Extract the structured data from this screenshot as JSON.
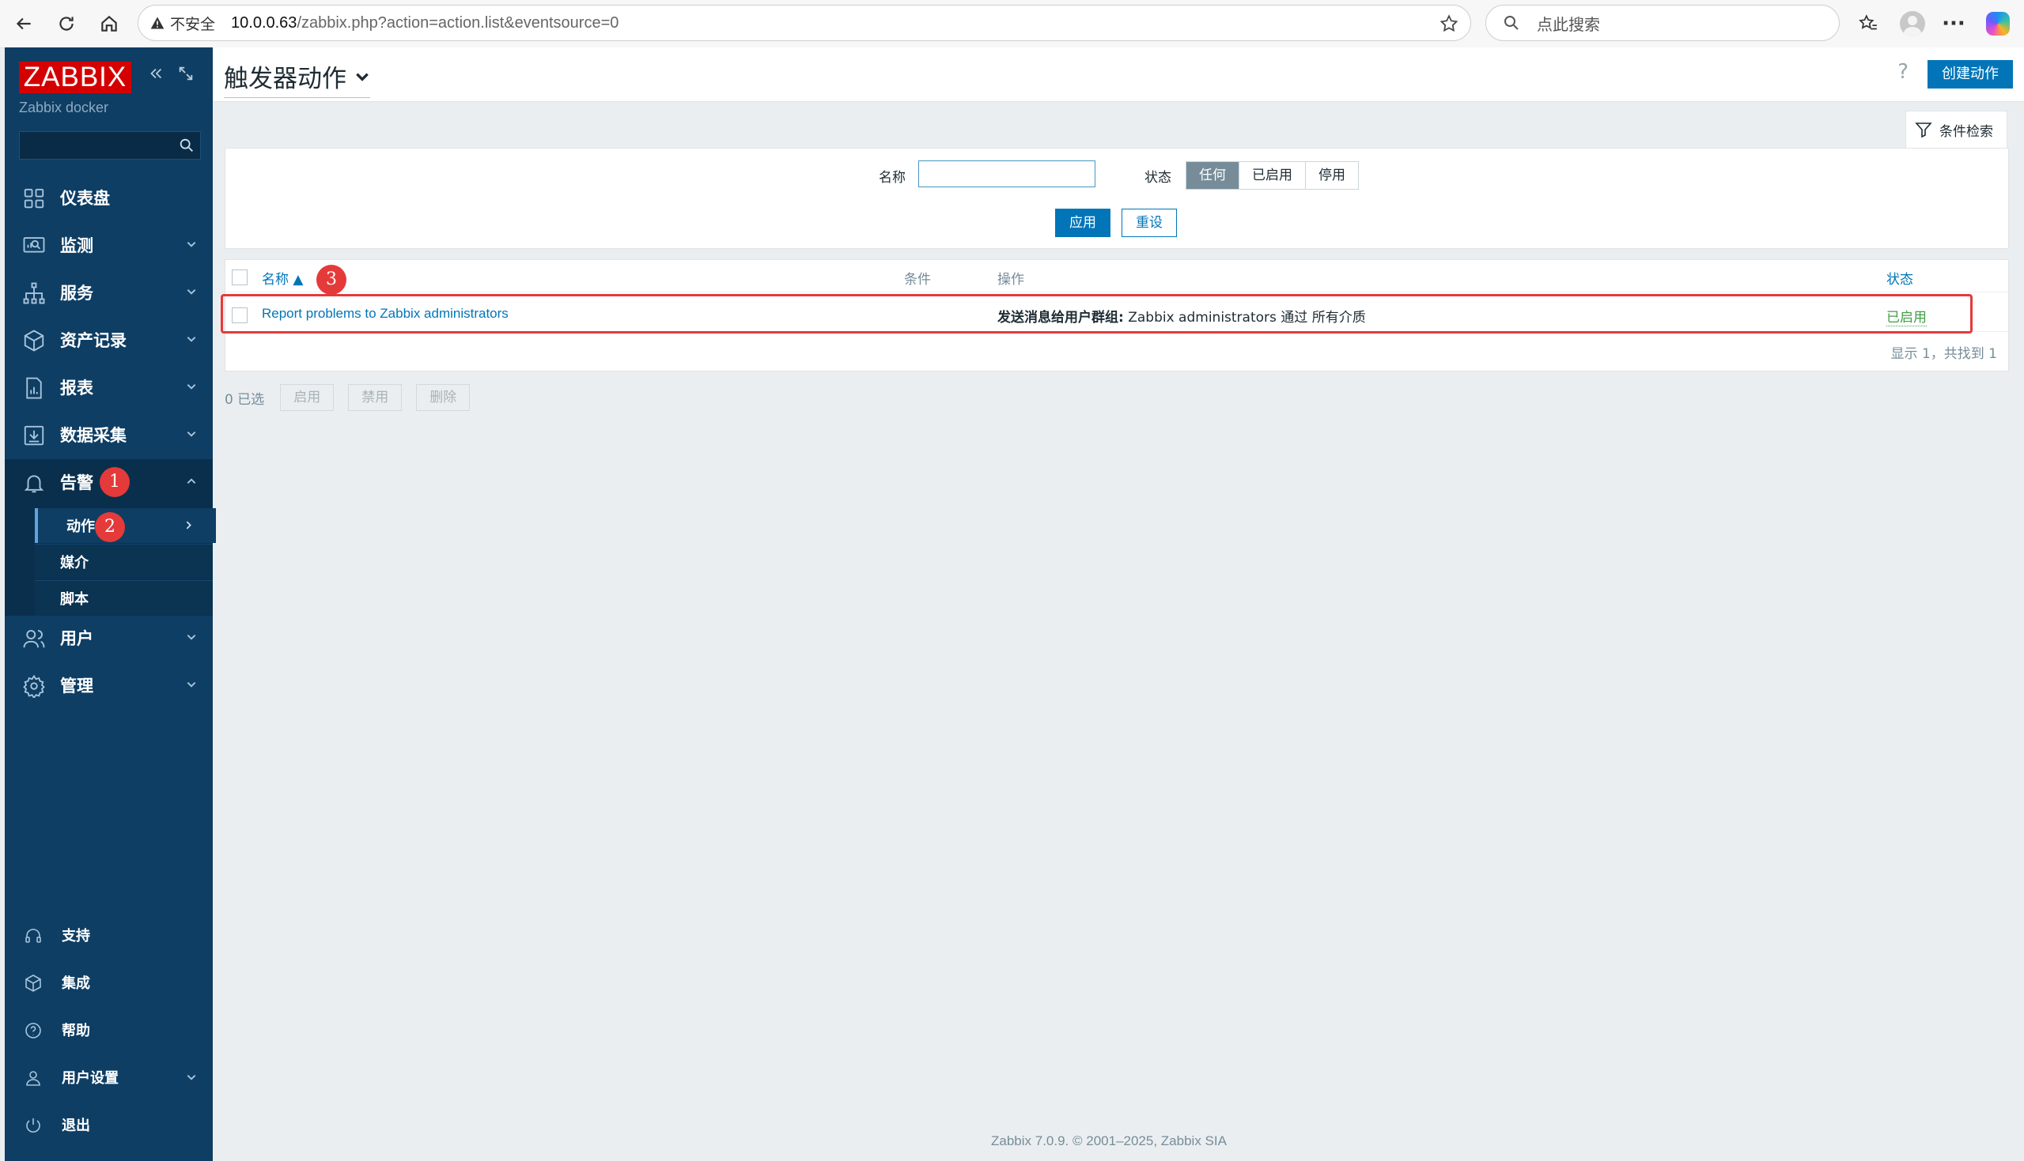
{
  "browser": {
    "security_label": "不安全",
    "url_host": "10.0.0.63",
    "url_path": "/zabbix.php?action=action.list&eventsource=0",
    "search_placeholder": "点此搜索"
  },
  "sidebar": {
    "logo": "ZABBIX",
    "server_name": "Zabbix docker",
    "menu": [
      {
        "label": "仪表盘",
        "icon": "dashboard-icon"
      },
      {
        "label": "监测",
        "icon": "monitoring-icon"
      },
      {
        "label": "服务",
        "icon": "services-icon"
      },
      {
        "label": "资产记录",
        "icon": "inventory-icon"
      },
      {
        "label": "报表",
        "icon": "reports-icon"
      },
      {
        "label": "数据采集",
        "icon": "data-collection-icon"
      },
      {
        "label": "告警",
        "icon": "bell-icon"
      },
      {
        "label": "用户",
        "icon": "users-icon"
      },
      {
        "label": "管理",
        "icon": "gear-icon"
      }
    ],
    "alerts_submenu": [
      {
        "label": "动作"
      },
      {
        "label": "媒介"
      },
      {
        "label": "脚本"
      }
    ],
    "bottom": [
      {
        "label": "支持",
        "icon": "headset-icon"
      },
      {
        "label": "集成",
        "icon": "integrations-icon"
      },
      {
        "label": "帮助",
        "icon": "help-icon"
      },
      {
        "label": "用户设置",
        "icon": "user-icon"
      },
      {
        "label": "退出",
        "icon": "power-icon"
      }
    ]
  },
  "annotations": [
    "1",
    "2",
    "3"
  ],
  "header": {
    "title": "触发器动作",
    "help": "?",
    "create_button": "创建动作"
  },
  "filter": {
    "tab_label": "条件检索",
    "name_label": "名称",
    "name_value": "",
    "status_label": "状态",
    "status_options": [
      "任何",
      "已启用",
      "停用"
    ],
    "status_selected": "任何",
    "apply": "应用",
    "reset": "重设"
  },
  "table": {
    "columns": {
      "name": "名称 ▲",
      "conditions": "条件",
      "operations": "操作",
      "status": "状态"
    },
    "rows": [
      {
        "name": "Report problems to Zabbix administrators",
        "conditions": "",
        "operation_prefix": "发送消息给用户群组:",
        "operation_text": " Zabbix administrators 通过 所有介质",
        "status": "已启用"
      }
    ],
    "footer": "显示 1，共找到 1"
  },
  "bulk": {
    "selected": "0 已选",
    "enable": "启用",
    "disable": "禁用",
    "delete": "删除"
  },
  "footer": "Zabbix 7.0.9. © 2001–2025, Zabbix SIA",
  "colors": {
    "sidebar": "#0e3e64",
    "accent": "#0275b8",
    "logo": "#d40000",
    "enabled": "#429e47",
    "annotation": "#e53a3a"
  }
}
